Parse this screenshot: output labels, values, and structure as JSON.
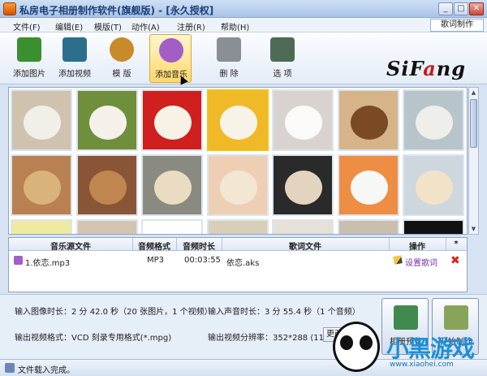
{
  "window": {
    "title": "私房电子相册制作软件(旗舰版) - [永久授权]",
    "controls": [
      "_",
      "□",
      "✕"
    ]
  },
  "menu": {
    "items": [
      "文件(F)",
      "编辑(E)",
      "模版(T)",
      "动作(A)",
      "注册(R)",
      "帮助(H)"
    ],
    "lyrics_button": "歌词制作"
  },
  "toolbar": {
    "tools": [
      {
        "label": "添加图片",
        "icon": "add-image-icon",
        "color": "#3a8f2e"
      },
      {
        "label": "添加视频",
        "icon": "add-video-icon",
        "color": "#2c6f8c"
      },
      {
        "label": "模  版",
        "icon": "template-palette-icon",
        "color": "#c98a2a"
      },
      {
        "label": "添加音乐",
        "icon": "add-music-icon",
        "color": "#a35ec6",
        "active": true
      },
      {
        "label": "删  除",
        "icon": "trash-icon",
        "color": "#8a8f96"
      },
      {
        "label": "选  项",
        "icon": "options-icon",
        "color": "#4d6a55"
      }
    ],
    "logo_prefix": "SiF",
    "logo_accent": "a",
    "logo_suffix": "ng"
  },
  "gallery": {
    "thumbs": [
      {
        "bg": "#cfc3b0",
        "dog": "#f2efe9",
        "sel": false
      },
      {
        "bg": "#6f8f3d",
        "dog": "#f4f1ea",
        "sel": false
      },
      {
        "bg": "#cf1f1f",
        "dog": "#f7f1e6",
        "sel": false
      },
      {
        "bg": "#f0b928",
        "dog": "#f8f3e8",
        "sel": true
      },
      {
        "bg": "#d9d3cf",
        "dog": "#fbfaf8",
        "sel": false
      },
      {
        "bg": "#d6b488",
        "dog": "#7a4a24",
        "sel": false
      },
      {
        "bg": "#b7c4c9",
        "dog": "#eeeeea",
        "sel": false
      },
      {
        "bg": "#b98052",
        "dog": "#d9b37b",
        "sel": false
      },
      {
        "bg": "#8a5536",
        "dog": "#c08650",
        "sel": false
      },
      {
        "bg": "#8a8a80",
        "dog": "#e9dcc2",
        "sel": false
      },
      {
        "bg": "#efcfb4",
        "dog": "#f3e7d3",
        "sel": false
      },
      {
        "bg": "#2b2a2a",
        "dog": "#e3d4c0",
        "sel": false
      },
      {
        "bg": "#ee8e44",
        "dog": "#f7f7f5",
        "sel": false
      },
      {
        "bg": "#cfd7de",
        "dog": "#f2e3c8",
        "sel": false
      },
      {
        "bg": "#eeeaa0",
        "dog": "#f6f3e6",
        "sel": false
      },
      {
        "bg": "#d4c5b2",
        "dog": "#f3ece2",
        "sel": false
      },
      {
        "bg": "#ffffff",
        "dog": "#ede9e2",
        "sel": false
      },
      {
        "bg": "#d8ceba",
        "dog": "#f4efe5",
        "sel": false
      },
      {
        "bg": "#e5e0d8",
        "dog": "#faf7f2",
        "sel": false
      },
      {
        "bg": "#c9bfae",
        "dog": "#efe8dd",
        "sel": false
      },
      {
        "bg": "#111111",
        "dog": "#222222",
        "sel": false
      }
    ]
  },
  "table": {
    "headers": [
      "音乐源文件",
      "音频格式",
      "音频时长",
      "歌词文件",
      "操作",
      "*"
    ],
    "rows": [
      {
        "file": "1.依恋.mp3",
        "format": "MP3",
        "duration": "00:03:55",
        "lyrics": "依恋.aks",
        "action": "设置歌词"
      }
    ]
  },
  "info": {
    "image_duration": "输入图像时长：2 分 42.0 秒（20 张图片，1 个视频）",
    "audio_duration": "输入声音时长：3 分 55.4 秒（1 个音频）",
    "output_format": "输出视频格式：VCD 刻录专用格式(*.mpg)",
    "output_resolution": "输出视频分辨率：352*288 (11:9)",
    "change_label": "更改",
    "left_big_label": "相册预览",
    "right_big_label": "开始制作"
  },
  "status": {
    "text": "文件载入完成。"
  },
  "watermark": {
    "text": "小黑游戏",
    "url": "www.xiaohei.com"
  }
}
